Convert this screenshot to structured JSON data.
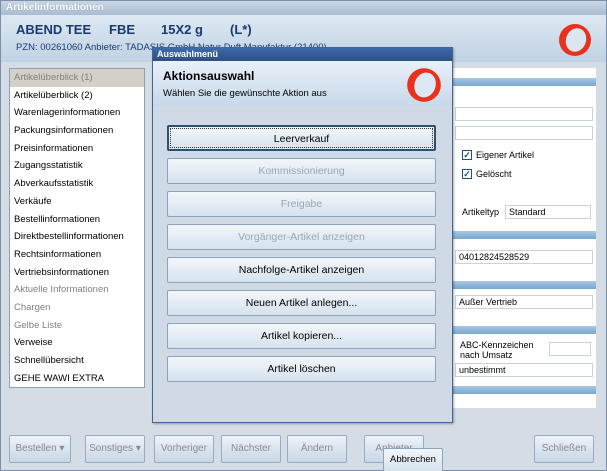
{
  "window": {
    "title": "Artikelinformationen",
    "header": {
      "product_name": "ABEND TEE",
      "form": "FBE",
      "size": "15X2 g",
      "flag": "(L*)",
      "pzn_line": "PZN: 00261060      Anbieter: TADASIS GmbH Natur Duft Manufaktur (21400)"
    }
  },
  "sidebar": {
    "items": [
      {
        "label": "Artikelüberblick (1)",
        "state": "selected"
      },
      {
        "label": "Artikelüberblick (2)",
        "state": "enabled"
      },
      {
        "label": "Warenlagerinformationen",
        "state": "enabled"
      },
      {
        "label": "Packungsinformationen",
        "state": "enabled"
      },
      {
        "label": "Preisinformationen",
        "state": "enabled"
      },
      {
        "label": "Zugangsstatistik",
        "state": "enabled"
      },
      {
        "label": "Abverkaufsstatistik",
        "state": "enabled"
      },
      {
        "label": "Verkäufe",
        "state": "enabled"
      },
      {
        "label": "Bestellinformationen",
        "state": "enabled"
      },
      {
        "label": "Direktbestellinformationen",
        "state": "enabled"
      },
      {
        "label": "Rechtsinformationen",
        "state": "enabled"
      },
      {
        "label": "Vertriebsinformationen",
        "state": "enabled"
      },
      {
        "label": "Aktuelle Informationen",
        "state": "disabled"
      },
      {
        "label": "Chargen",
        "state": "disabled"
      },
      {
        "label": "Gelbe Liste",
        "state": "disabled"
      },
      {
        "label": "Verweise",
        "state": "enabled"
      },
      {
        "label": "Schnellübersicht",
        "state": "enabled"
      },
      {
        "label": "GEHE WAWI EXTRA",
        "state": "enabled"
      }
    ]
  },
  "right_panel": {
    "eigener_artikel_label": "Eigener Artikel",
    "eigener_artikel_checked": true,
    "geloescht_label": "Gelöscht",
    "geloescht_checked": true,
    "artikeltyp_label": "Artikeltyp",
    "artikeltyp_value": "Standard",
    "number_value": "04012824528529",
    "vertrieb_value": "Außer Vertrieb",
    "abc_label": "ABC-Kennzeichen nach Umsatz",
    "abc_value": "unbestimmt"
  },
  "bottom_buttons": [
    {
      "label": "Bestellen",
      "dropdown": true
    },
    {
      "label": "Sonstiges",
      "dropdown": true
    },
    {
      "label": "Vorheriger",
      "dropdown": false
    },
    {
      "label": "Nächster",
      "dropdown": false
    },
    {
      "label": "Ändern",
      "dropdown": false
    },
    {
      "label": "Anbieter",
      "dropdown": false
    },
    {
      "label": "Schließen",
      "dropdown": false
    }
  ],
  "dialog": {
    "title": "Auswahlmenü",
    "heading": "Aktionsauswahl",
    "subheading": "Wählen Sie die gewünschte Aktion aus",
    "actions": [
      {
        "label": "Leerverkauf",
        "enabled": true,
        "focused": true
      },
      {
        "label": "Kommissionierung",
        "enabled": false,
        "focused": false
      },
      {
        "label": "Freigabe",
        "enabled": false,
        "focused": false
      },
      {
        "label": "Vorgänger-Artikel anzeigen",
        "enabled": false,
        "focused": false
      },
      {
        "label": "Nachfolge-Artikel anzeigen",
        "enabled": true,
        "focused": false
      },
      {
        "label": "Neuen Artikel anlegen...",
        "enabled": true,
        "focused": false
      },
      {
        "label": "Artikel kopieren...",
        "enabled": true,
        "focused": false
      },
      {
        "label": "Artikel löschen",
        "enabled": true,
        "focused": false
      }
    ],
    "cancel_label": "Abbrechen"
  },
  "colors": {
    "logo_red": "#e8321e",
    "title_blue": "#1a3a6e",
    "dialog_titlebar": "#2b4f84"
  },
  "icons": {
    "logo": "ring-logo-icon",
    "dropdown": "chevron-down-icon",
    "check": "checkmark-icon"
  }
}
